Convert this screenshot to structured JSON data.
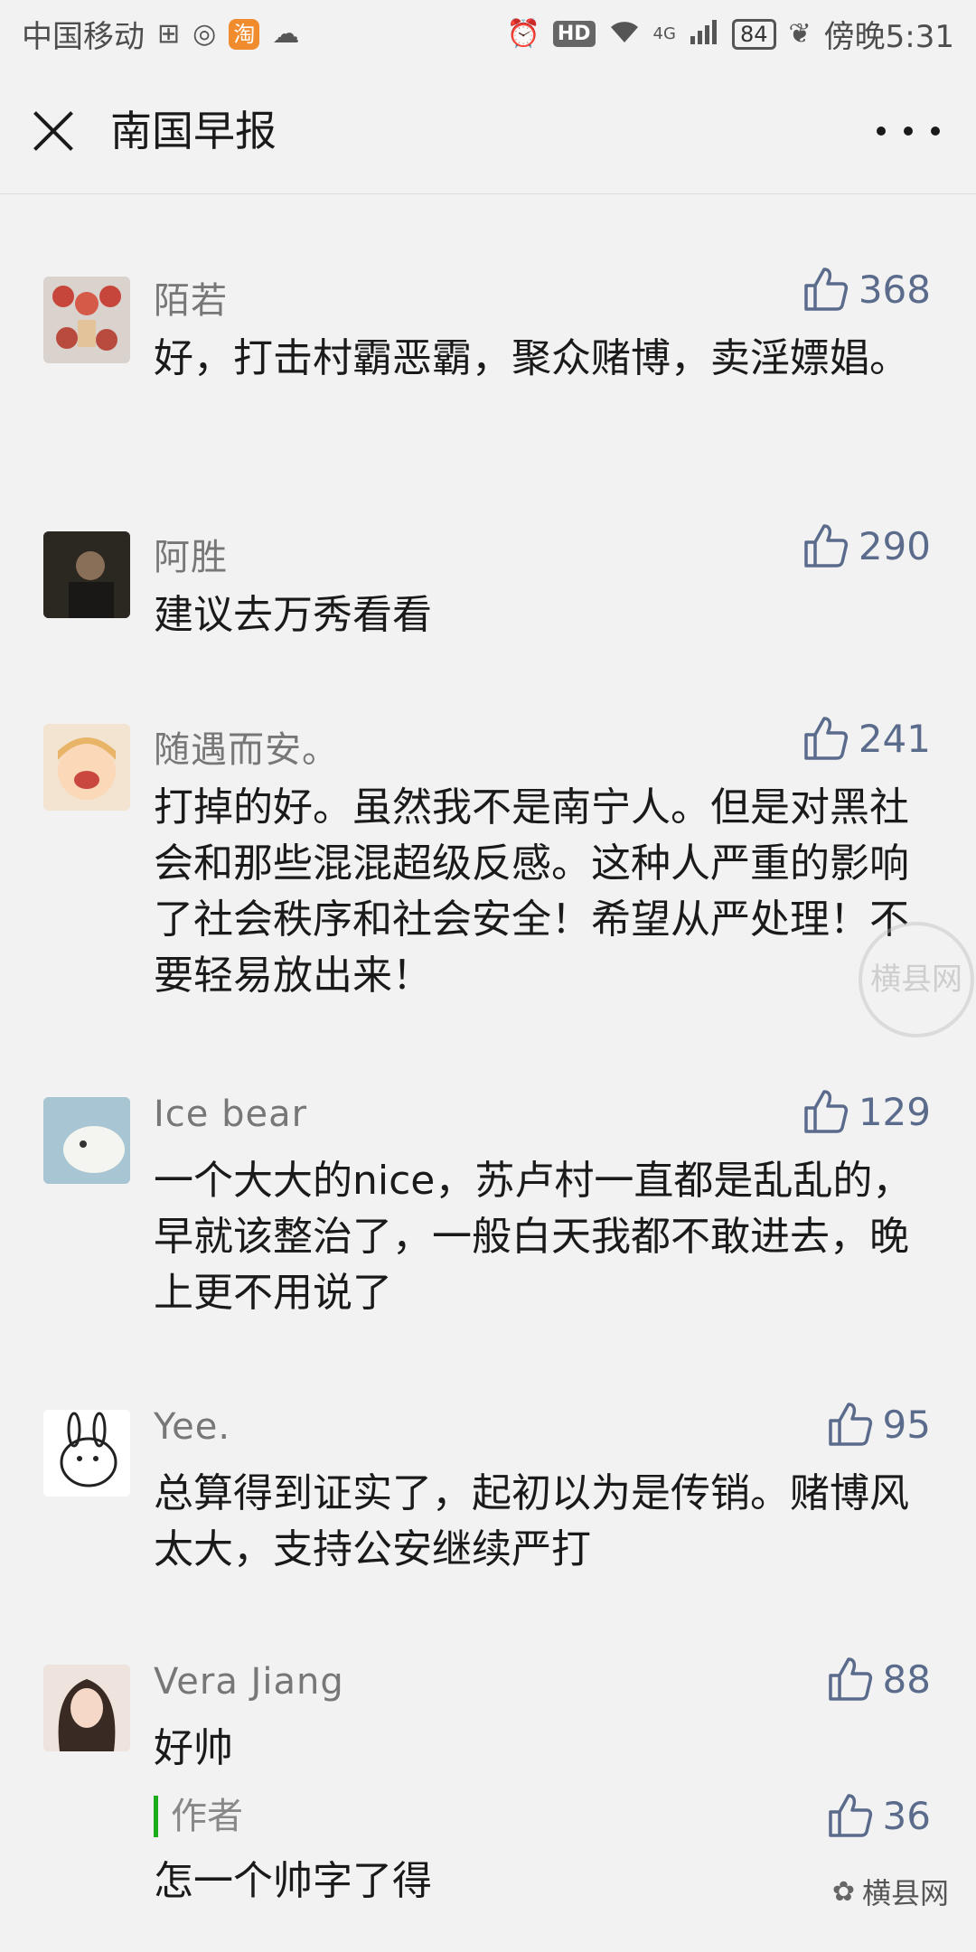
{
  "status_bar": {
    "carrier": "中国移动",
    "taobao": "淘",
    "hd": "HD",
    "network": "4G",
    "battery": "84",
    "time": "傍晚5:31"
  },
  "nav": {
    "title": "南国早报"
  },
  "comments": [
    {
      "name": "陌若",
      "likes": "368",
      "text": "好，打击村霸恶霸，聚众赌博，卖淫嫖娼。"
    },
    {
      "name": "阿胜",
      "likes": "290",
      "text": "建议去万秀看看"
    },
    {
      "name": "随遇而安。",
      "likes": "241",
      "text": "打掉的好。虽然我不是南宁人。但是对黑社会和那些混混超级反感。这种人严重的影响了社会秩序和社会安全！希望从严处理！不要轻易放出来！"
    },
    {
      "name": "Ice bear",
      "likes": "129",
      "text": "一个大大的nice，苏卢村一直都是乱乱的，早就该整治了，一般白天我都不敢进去，晚上更不用说了"
    },
    {
      "name": "Yee.",
      "likes": "95",
      "text": "总算得到证实了，起初以为是传销。赌博风太大，支持公安继续严打"
    },
    {
      "name": "Vera Jiang",
      "likes": "88",
      "text": "好帅"
    }
  ],
  "author_reply": {
    "label": "作者",
    "likes": "36",
    "text": "怎一个帅字了得"
  },
  "watermark": {
    "circle": "横县网",
    "bottom": "横县网"
  }
}
